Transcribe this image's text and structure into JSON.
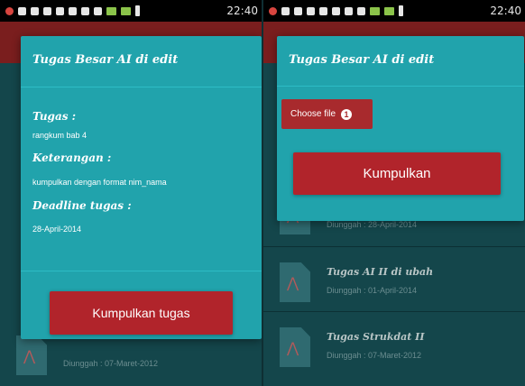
{
  "status_bar": {
    "time_left": "22:40",
    "time_right": "22:40"
  },
  "left_screen": {
    "dialog": {
      "title": "Tugas Besar AI di edit",
      "tugas_label": "Tugas :",
      "tugas_value": "rangkum bab 4",
      "keterangan_label": "Keterangan :",
      "keterangan_value": "kumpulkan dengan format nim_nama",
      "deadline_label": "Deadline tugas :",
      "deadline_value": "28-April-2014",
      "submit_button": "Kumpulkan tugas"
    },
    "background_list": [
      {
        "title": "",
        "subtitle": "Diunggah : 07-Maret-2012"
      }
    ]
  },
  "right_screen": {
    "dialog": {
      "title": "Tugas Besar AI di edit",
      "choose_file_button": "Choose file",
      "file_count_badge": "1",
      "submit_button": "Kumpulkan"
    },
    "background_list": [
      {
        "title": "",
        "subtitle": "Diunggah : 28-April-2014"
      },
      {
        "title": "Tugas AI II di ubah",
        "subtitle": "Diunggah : 01-April-2014"
      },
      {
        "title": "Tugas Strukdat II",
        "subtitle": "Diunggah : 07-Maret-2012"
      }
    ]
  }
}
